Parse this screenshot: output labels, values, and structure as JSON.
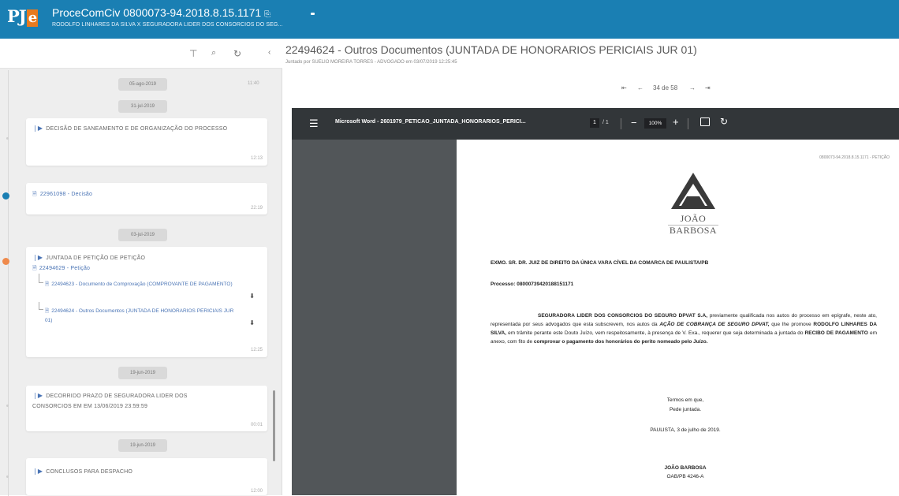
{
  "app": {
    "logo_text": "PJ",
    "logo_e": "e",
    "process_title": "ProceComCiv 0800073-94.2018.8.15.1171",
    "process_parties": "RODOLFO LINHARES DA SILVA X SEGURADORA LIDER DOS CONSORCIOS DO SEG..."
  },
  "toolbar": {
    "filter_icon": "filter-icon",
    "search_icon": "search-icon",
    "refresh_icon": "refresh-icon",
    "collapse_icon": "chevron-left-icon"
  },
  "timeline": {
    "top_date": "05-ago-2019",
    "top_time": "11:40",
    "date1": "31-jul-2019",
    "event1": {
      "title": "DECISÃO DE SANEAMENTO E DE ORGANIZAÇÃO DO PROCESSO",
      "time": "12:13"
    },
    "event2": {
      "title": "22961098 - Decisão",
      "time": "22:19"
    },
    "date2": "03-jul-2019",
    "event3": {
      "title": "JUNTADA DE PETIÇÃO DE PETIÇÃO",
      "doc": "22494629 - Petição",
      "sub1": "22494623 - Documento de Comprovação (COMPROVANTE DE PAGAMENTO)",
      "sub2": "22494624 - Outros Documentos (JUNTADA DE HONORARIOS PERICIAIS JUR 01)",
      "time": "12:25"
    },
    "date3": "19-jun-2019",
    "event4": {
      "title": "DECORRIDO PRAZO DE SEGURADORA LIDER DOS CONSORCIOS EM EM 13/06/2019 23:59:59",
      "time": "00:01"
    },
    "date4": "19-jun-2019",
    "event5": {
      "title": "CONCLUSOS PARA DESPACHO",
      "time": "12:00"
    }
  },
  "document": {
    "title": "22494624 - Outros Documentos (JUNTADA DE HONORARIOS PERICIAIS JUR 01)",
    "subtitle": "Juntado por SUELIO MOREIRA TORRES - ADVOGADO em 03/07/2019 12:25:45",
    "pager_text": "34 de 58"
  },
  "viewer": {
    "filename": "Microsoft Word - 2601979_PETICAO_JUNTADA_HONORARIOS_PERICI...",
    "page_current": "1",
    "page_total": "/ 1",
    "zoom": "100%"
  },
  "page": {
    "code": "0800073-94.2018.8.15.1171 - PETIÇÃO",
    "brand": "JOÃO BARBOSA",
    "addressee": "EXMO. SR. DR. JUIZ DE DIREITO DA ÚNICA VARA CÍVEL DA COMARCA DE PAULISTA/PB",
    "processo": "Processo: 08000739420188151171",
    "body_bold1": "SEGURADORA LIDER DOS CONSORCIOS DO SEGURO DPVAT S.A,",
    "body1": " previamente qualificada nos autos do processo em epígrafe, neste ato, representada por seus advogados que esta subscrevem, nos autos da ",
    "body_bold2": "AÇÃO DE COBRANÇA DE SEGURO DPVAT,",
    "body2": " que lhe promove ",
    "body_bold3": "RODOLFO LINHARES DA SILVA,",
    "body3": " em trâmite perante este Douto Juízo, vem respeitosamente, à presença de V. Exa., requerer que seja determinada a juntada do ",
    "body_bold4": "RECIBO DE PAGAMENTO",
    "body4": " em anexo, com fito de ",
    "body_bold5": "comprovar o pagamento dos honorários do perito nomeado pelo Juízo.",
    "closing1": "Termos em que,",
    "closing2": "Pede juntada.",
    "place_date": "PAULISTA, 3 de julho de 2019.",
    "signer": "JOÃO BARBOSA",
    "oab": "OAB/PB 4246-A"
  },
  "colors": {
    "topbar": "#1a7fb3",
    "accent_blue": "#4a74b5",
    "dot_orange": "#ef8a4c",
    "dot_blue": "#1a7fb3"
  }
}
